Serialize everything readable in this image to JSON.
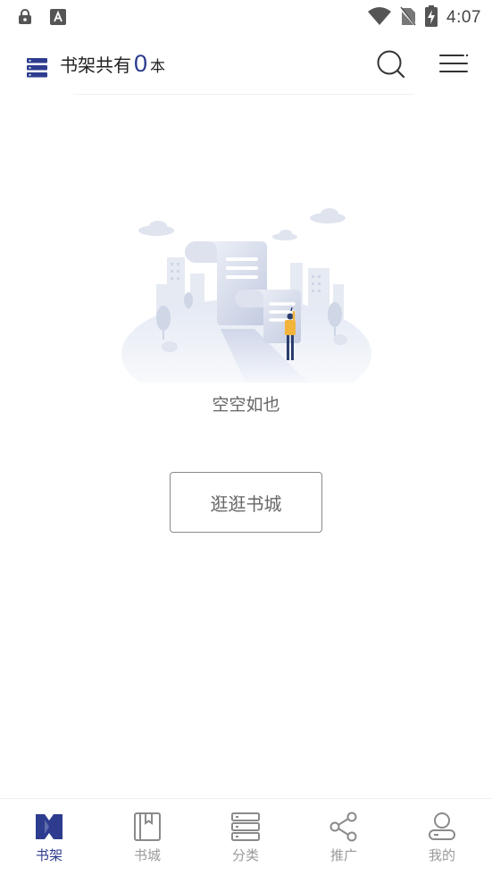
{
  "status_bar": {
    "time": "4:07"
  },
  "header": {
    "title_prefix": "书架共有",
    "book_count": "0",
    "title_unit": "本"
  },
  "empty_state": {
    "message": "空空如也",
    "browse_button": "逛逛书城"
  },
  "bottom_nav": {
    "active_index": 0,
    "items": [
      {
        "label": "书架",
        "icon": "bookshelf-icon"
      },
      {
        "label": "书城",
        "icon": "book-icon"
      },
      {
        "label": "分类",
        "icon": "category-icon"
      },
      {
        "label": "推广",
        "icon": "share-icon"
      },
      {
        "label": "我的",
        "icon": "profile-icon"
      }
    ]
  },
  "colors": {
    "accent": "#2d3c8f",
    "inactive": "#9a9a9a"
  }
}
